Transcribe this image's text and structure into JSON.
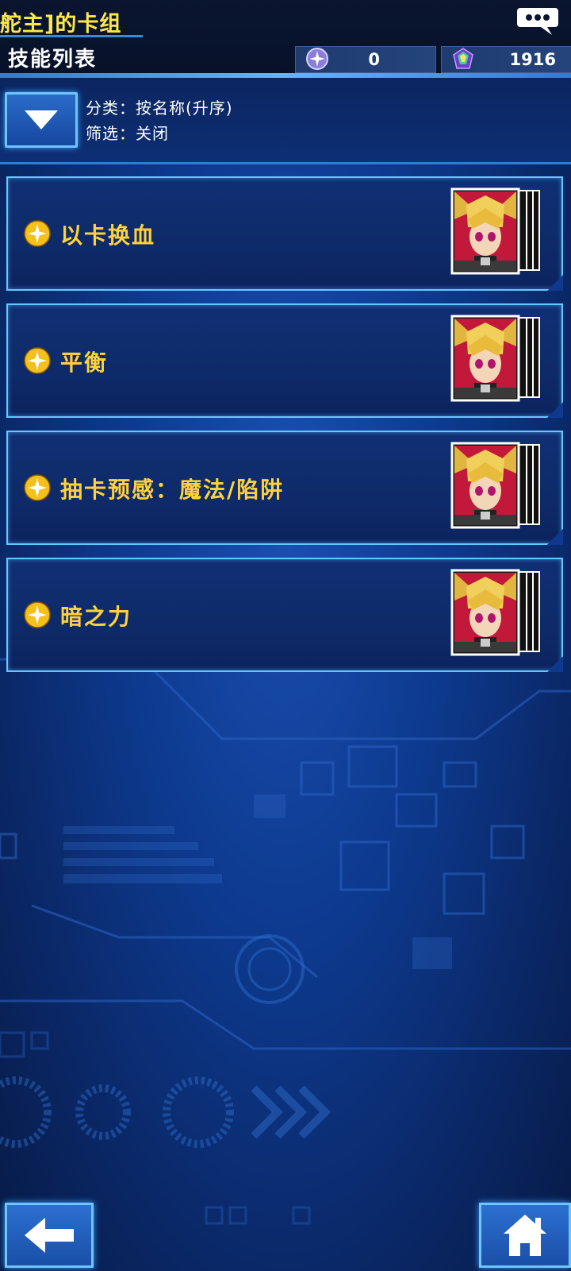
{
  "header": {
    "deck_title": "舵主]的卡组",
    "page_title": "技能列表",
    "currencies": [
      {
        "icon": "purple-orb-icon",
        "value": "0"
      },
      {
        "icon": "gem-icon",
        "value": "1916"
      }
    ]
  },
  "sort": {
    "sort_label": "分类：按名称(升序)",
    "filter_label": "筛选：关闭"
  },
  "skills": [
    {
      "icon": "sparkle-icon",
      "name": "以卡换血",
      "portrait": "character-portrait"
    },
    {
      "icon": "sparkle-icon",
      "name": "平衡",
      "portrait": "character-portrait"
    },
    {
      "icon": "sparkle-icon",
      "name": "抽卡预感：魔法/陷阱",
      "portrait": "character-portrait"
    },
    {
      "icon": "sparkle-icon",
      "name": "暗之力",
      "portrait": "character-portrait"
    }
  ],
  "colors": {
    "accent": "#64c8ff",
    "title_yellow": "#ffe84a",
    "skill_name": "#ffd23c",
    "background": "#0d3a8f"
  }
}
